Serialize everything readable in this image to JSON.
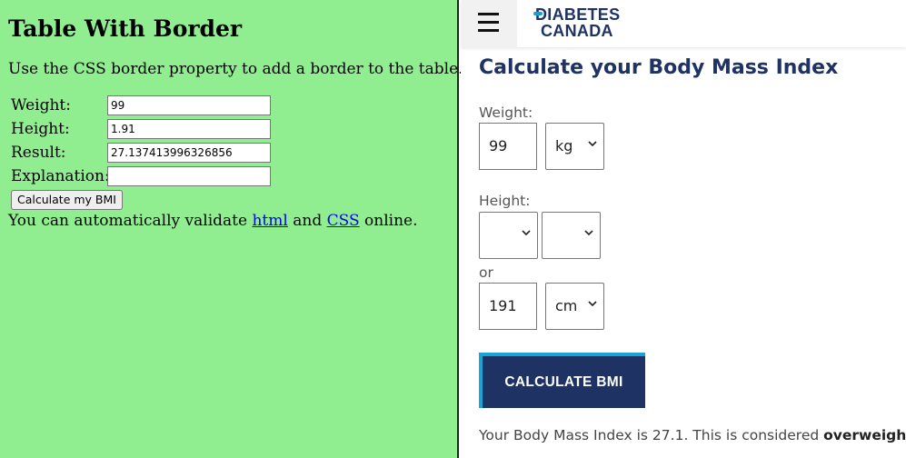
{
  "left": {
    "title": "Table With Border",
    "description": "Use the CSS border property to add a border to the table.",
    "rows": [
      {
        "label": "Weight:",
        "value": "99"
      },
      {
        "label": "Height:",
        "value": "1.91"
      },
      {
        "label": "Result:",
        "value": "27.137413996326856"
      },
      {
        "label": "Explanation:",
        "value": ""
      }
    ],
    "button_label": "Calculate my BMI",
    "validate": {
      "prefix": "You can automatically validate ",
      "link1": "html",
      "middle": " and ",
      "link2": "CSS",
      "suffix": " online."
    }
  },
  "right": {
    "logo_line1": "DIABETES",
    "logo_line2": "CANADA",
    "title": "Calculate your Body Mass Index",
    "weight_label": "Weight:",
    "weight_value": "99",
    "weight_unit": "kg",
    "height_label": "Height:",
    "height_feet": "",
    "height_inches": "",
    "or_label": "or",
    "height_value": "191",
    "height_unit": "cm",
    "calc_button": "CALCULATE BMI",
    "result_prefix": "Your Body Mass Index is 27.1. This is considered ",
    "result_category": "overweight",
    "result_suffix": "."
  },
  "colors": {
    "left_background": "#90ee90",
    "brand_navy": "#1e3264",
    "brand_blue": "#14a0d2"
  },
  "icons": [
    "hamburger-menu-icon",
    "chevron-down-icon"
  ]
}
